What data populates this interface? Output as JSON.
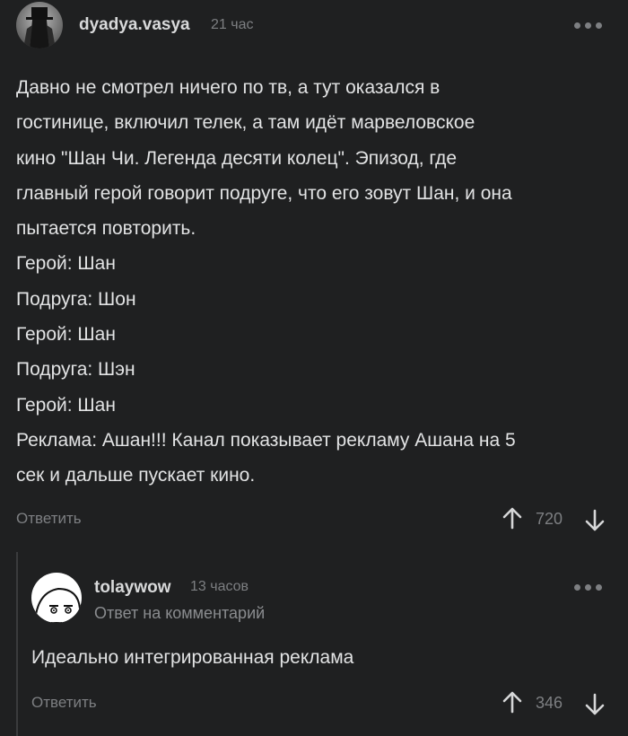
{
  "comment1": {
    "username": "dyadya.vasya",
    "time": "21 час",
    "lines": [
      "Давно не смотрел ничего по тв, а тут оказался в",
      "гостинице, включил телек, а там идёт марвеловское",
      "кино \"Шан Чи. Легенда десяти колец\". Эпизод, где",
      "главный герой говорит подруге, что его зовут Шан, и она",
      "пытается повторить.",
      "Герой: Шан",
      "Подруга: Шон",
      "Герой: Шан",
      "Подруга: Шэн",
      "Герой: Шан",
      "Реклама: Ашан!!! Канал показывает рекламу Ашана на 5",
      "сек и дальше пускает кино."
    ],
    "reply_label": "Ответить",
    "rating": "720",
    "menu_icon": "more-dots-icon"
  },
  "comment2": {
    "username": "tolaywow",
    "time": "13 часов",
    "subtitle": "Ответ на комментарий",
    "text": "Идеально интегрированная реклама",
    "reply_label": "Ответить",
    "rating": "346",
    "menu_icon": "more-dots-icon"
  },
  "colors": {
    "background": "#1f2021",
    "text": "#e2e3e4",
    "muted": "#7d7f82"
  }
}
